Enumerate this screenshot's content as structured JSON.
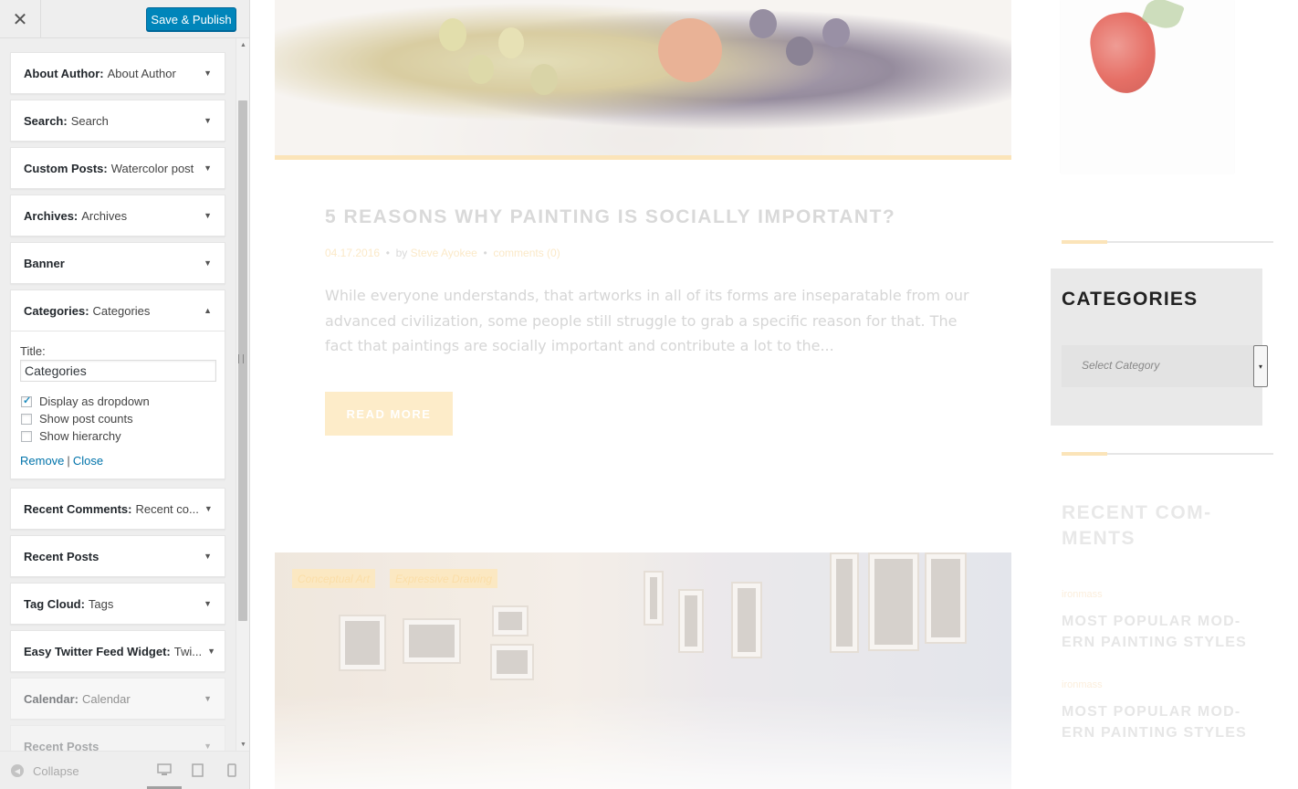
{
  "header": {
    "close_glyph": "✕",
    "publish_label": "Save & Publish"
  },
  "widgets": [
    {
      "name": "About Author:",
      "sub": "About Author"
    },
    {
      "name": "Search:",
      "sub": "Search"
    },
    {
      "name": "Custom Posts:",
      "sub": "Watercolor post"
    },
    {
      "name": "Archives:",
      "sub": "Archives"
    },
    {
      "name": "Banner",
      "sub": ""
    },
    {
      "name": "Categories:",
      "sub": "Categories"
    },
    {
      "name": "Recent Comments:",
      "sub": "Recent co..."
    },
    {
      "name": "Recent Posts",
      "sub": ""
    },
    {
      "name": "Tag Cloud:",
      "sub": "Tags"
    },
    {
      "name": "Easy Twitter Feed Widget:",
      "sub": "Twi..."
    },
    {
      "name": "Calendar:",
      "sub": "Calendar"
    },
    {
      "name": "Recent Posts",
      "sub": ""
    }
  ],
  "arrows": {
    "down": "▼",
    "up": "▲"
  },
  "categories_form": {
    "title_label": "Title:",
    "title_value": "Categories",
    "options": [
      {
        "label": "Display as dropdown",
        "checked": true
      },
      {
        "label": "Show post counts",
        "checked": false
      },
      {
        "label": "Show hierarchy",
        "checked": false
      }
    ],
    "remove_label": "Remove",
    "separator": "|",
    "close_label": "Close"
  },
  "footer": {
    "collapse_glyph": "◀",
    "collapse_label": "Collapse",
    "devices": [
      "desktop-icon",
      "tablet-icon",
      "mobile-icon"
    ]
  },
  "preview": {
    "post": {
      "title": "5 REASONS WHY PAINTING IS SOCIALLY IMPORTANT?",
      "date": "04.17.2016",
      "by": "by",
      "author": "Steve Ayokee",
      "comments": "comments (0)",
      "bullet": "•",
      "excerpt": "While everyone understands, that artworks in all of its forms are inseparatable from our advanced civilization, some people still struggle to grab a specific reason for that. The fact that paintings are socially important and contribute a lot to the...",
      "read_more": "READ MORE"
    },
    "gallery_tags": [
      "Conceptual Art",
      "Expressive Drawing"
    ],
    "categories_widget": {
      "title": "CATEGORIES",
      "select_placeholder": "Select Category",
      "select_arrow": "▾"
    },
    "recent_comments": {
      "title": "RECENT COM-MENTS",
      "items": [
        {
          "author": "ironmass",
          "title": "MOST POPULAR MOD-ERN PAINTING STYLES"
        },
        {
          "author": "ironmass",
          "title": "MOST POPULAR MOD-ERN PAINTING STYLES"
        }
      ]
    }
  },
  "colors": {
    "primary_button": "#0085ba",
    "link": "#0073aa",
    "accent": "#fbe4b9"
  }
}
